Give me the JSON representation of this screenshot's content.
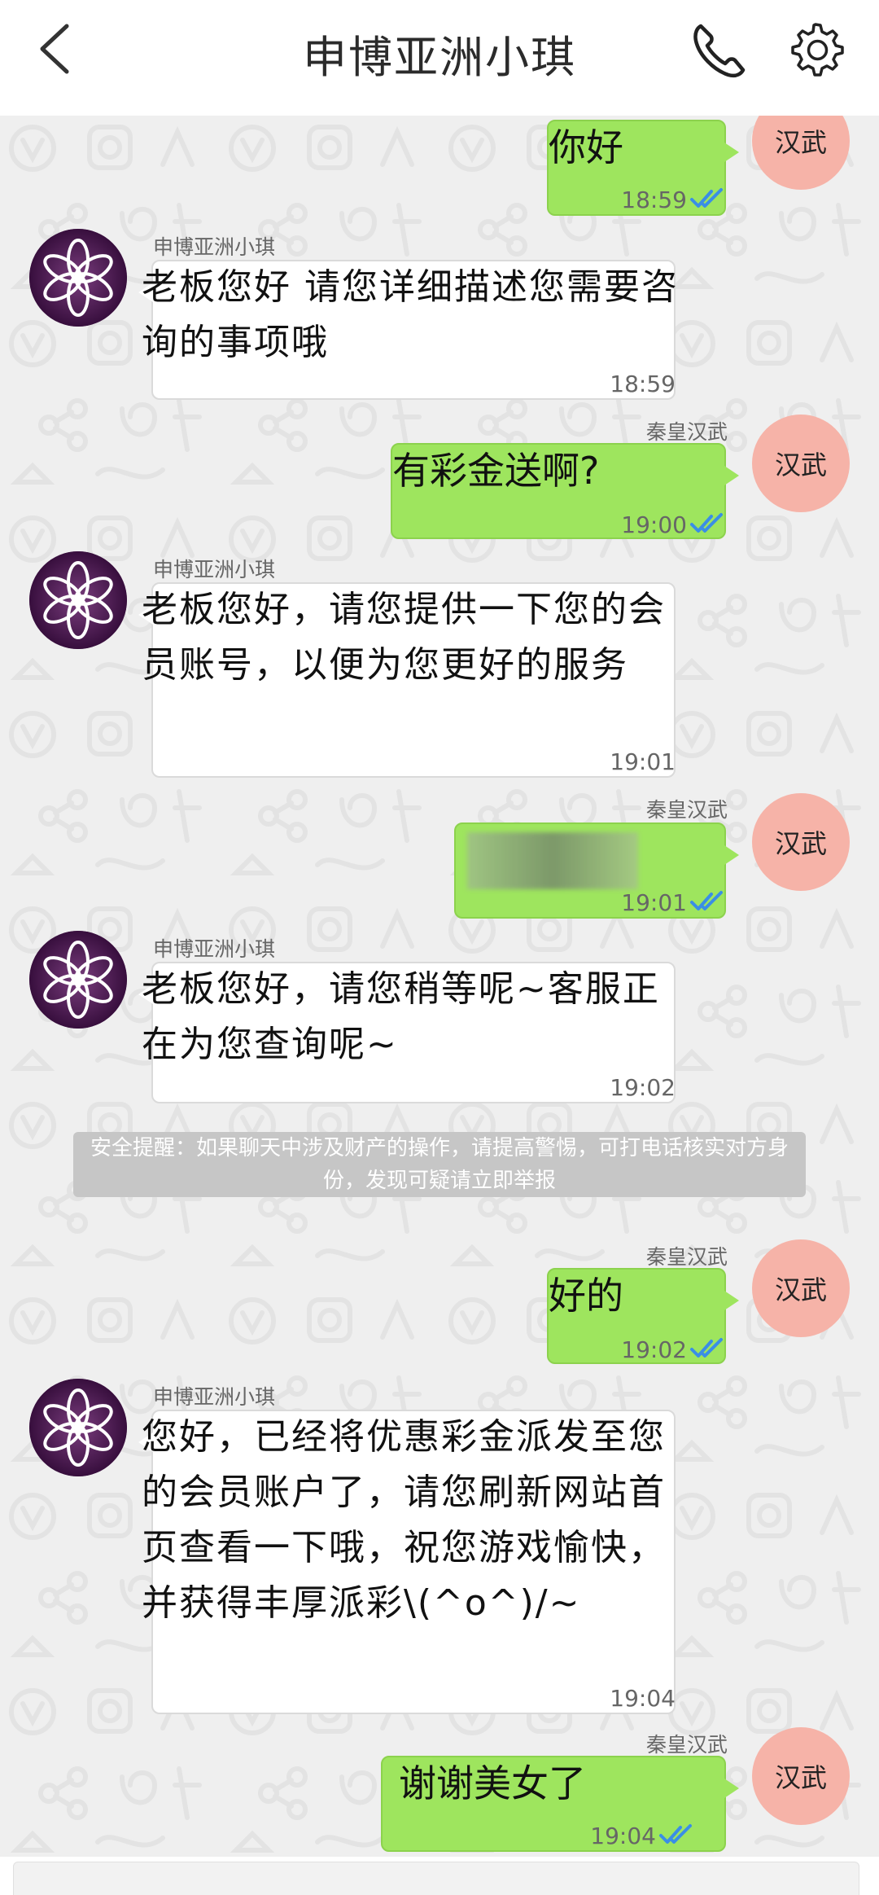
{
  "header": {
    "title": "申博亚洲小琪",
    "back_icon": "chevron-left-icon",
    "call_icon": "phone-icon",
    "settings_icon": "gear-icon"
  },
  "contact": {
    "name": "申博亚洲小琪",
    "avatar_icon": "flower-logo-icon"
  },
  "me": {
    "name": "秦皇汉武",
    "avatar_text": "汉武",
    "avatar_color": "#f6b3a8"
  },
  "messages": [
    {
      "from": "me",
      "text": "你好",
      "time": "18:59",
      "read": true
    },
    {
      "from": "contact",
      "text": "老板您好 请您详细描述您需要咨询的事项哦",
      "time": "18:59"
    },
    {
      "from": "me",
      "text": "有彩金送啊?",
      "time": "19:00",
      "read": true
    },
    {
      "from": "contact",
      "text": "老板您好，请您提供一下您的会员账号，以便为您更好的服务",
      "time": "19:01"
    },
    {
      "from": "me",
      "text": "",
      "time": "19:01",
      "read": true,
      "redacted": true
    },
    {
      "from": "contact",
      "text": "老板您好，请您稍等呢~客服正在为您查询呢~",
      "time": "19:02"
    },
    {
      "from": "me",
      "text": "好的",
      "time": "19:02",
      "read": true
    },
    {
      "from": "contact",
      "text": "您好，已经将优惠彩金派发至您的会员账户了，请您刷新网站首页查看一下哦，祝您游戏愉快，并获得丰厚派彩\\(^o^)/~",
      "time": "19:04"
    },
    {
      "from": "me",
      "text": "谢谢美女了",
      "time": "19:04",
      "read": true
    }
  ],
  "safety_notice": "安全提醒：如果聊天中涉及财产的操作，请提高警惕，可打电话核实对方身份，发现可疑请立即举报",
  "colors": {
    "my_bubble": "#9ee55e",
    "contact_bubble": "#ffffff",
    "read_ticks": "#3a8ee6",
    "chat_background": "#efefef"
  }
}
